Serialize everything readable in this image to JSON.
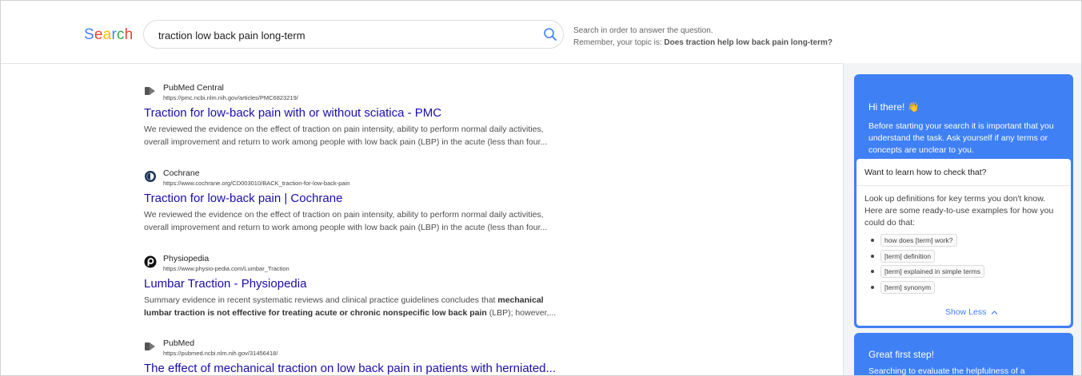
{
  "header": {
    "logo_letters": [
      "S",
      "e",
      "a",
      "r",
      "c",
      "h"
    ],
    "logo_colors": [
      "#4285f4",
      "#ea4335",
      "#fbbc05",
      "#4285f4",
      "#34a853",
      "#ea4335"
    ],
    "search_value": "traction low back pain long-term",
    "hint_line1": "Search in order to answer the question.",
    "hint_line2_prefix": "Remember, your topic is: ",
    "hint_topic": "Does traction help low back pain long-term?"
  },
  "results": [
    {
      "source": "PubMed Central",
      "url": "https://pmc.ncbi.nlm.nih.gov/articles/PMC6823219/",
      "title": "Traction for low-back pain with or without sciatica - PMC",
      "snippet_line1": "We reviewed the evidence on the effect of traction on pain intensity, ability to perform normal daily activities,",
      "snippet_line2": "overall improvement and return to work among people with low back pain (LBP) in the acute (less than four...",
      "favicon": "pubmed-icon"
    },
    {
      "source": "Cochrane",
      "url": "https://www.cochrane.org/CD003010/BACK_traction-for-low-back-pain",
      "title": "Traction for low-back pain | Cochrane",
      "snippet_line1": "We reviewed the evidence on the effect of traction on pain intensity, ability to perform normal daily activities,",
      "snippet_line2": "overall improvement and return to work among people with low back pain (LBP) in the acute (less than four...",
      "favicon": "cochrane-icon"
    },
    {
      "source": "Physiopedia",
      "url": "https://www.physio-pedia.com/Lumbar_Traction",
      "title": "Lumbar Traction - Physiopedia",
      "snippet_pre": "Summary evidence in recent systematic reviews and clinical practice guidelines concludes that ",
      "snippet_bold1": "mechanical",
      "snippet_bold2": "lumbar traction is not effective for treating acute or chronic nonspecific low back pain",
      "snippet_post": " (LBP); however,...",
      "favicon": "physiopedia-icon"
    },
    {
      "source": "PubMed",
      "url": "https://pubmed.ncbi.nlm.nih.gov/31456418/",
      "title": "The effect of mechanical traction on low back pain in patients with herniated...",
      "favicon": "pubmed-icon"
    }
  ],
  "panel": {
    "card1_title": "Hi there! 👋",
    "card1_text": "Before starting your search it is important that you understand the task. Ask yourself if any terms or concepts are unclear to you.",
    "inner_heading": "Want to learn how to check that?",
    "inner_text": "Look up definitions for key terms you don't know. Here are some ready-to-use examples for how you could do that:",
    "chips": [
      "how does [term] work?",
      "[term] definition",
      "[term] explained in simple terms",
      "[term] synonym"
    ],
    "show_less": "Show Less",
    "card2_title": "Great first step!",
    "card2_text": "Searching to evaluate the helpfulness of a"
  },
  "colors": {
    "accent": "#3f80f5",
    "link": "#1a0dab"
  }
}
